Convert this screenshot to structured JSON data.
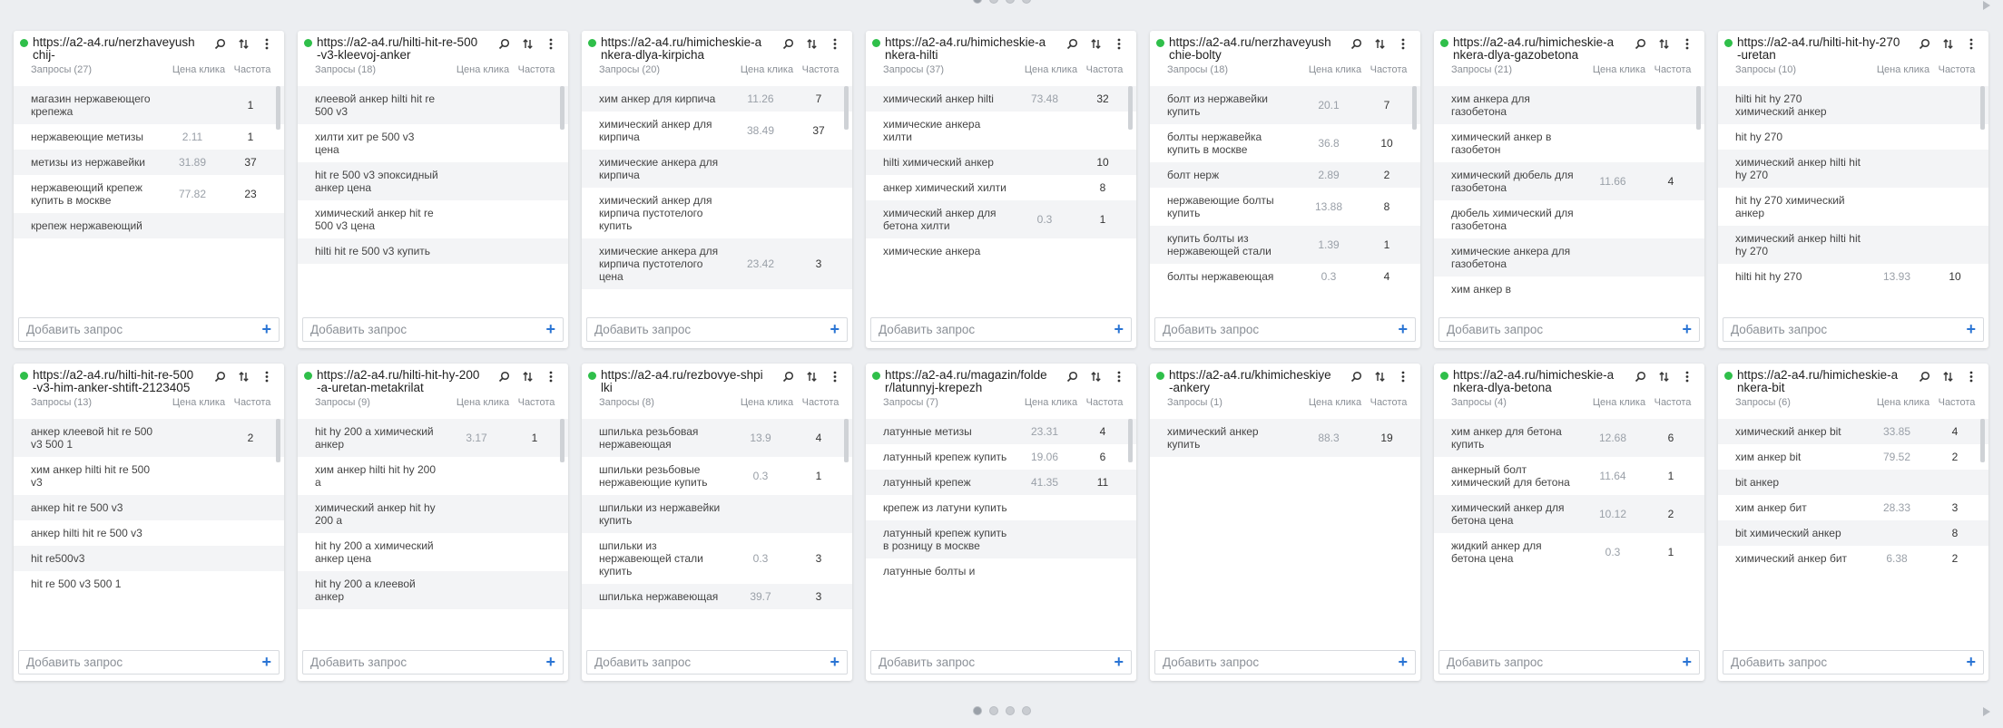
{
  "pager": {
    "count": 4,
    "active": 0
  },
  "labels": {
    "col_price": "Цена клика",
    "col_freq": "Частота",
    "add_query": "Добавить запрос",
    "add_plus": "+"
  },
  "cards": [
    {
      "url": "https://a2-a4.ru/nerzhaveyushchij-",
      "count": "Запросы (27)",
      "rows": [
        {
          "q": "магазин нержавеющего крепежа",
          "p": "",
          "f": "1"
        },
        {
          "q": "нержавеющие метизы",
          "p": "2.11",
          "f": "1"
        },
        {
          "q": "метизы из нержавейки",
          "p": "31.89",
          "f": "37"
        },
        {
          "q": "нержавеющий крепеж купить в москве",
          "p": "77.82",
          "f": "23"
        },
        {
          "q": "крепеж нержавеющий",
          "p": "",
          "f": ""
        }
      ]
    },
    {
      "url": "https://a2-a4.ru/hilti-hit-re-500-v3-kleevoj-anker",
      "count": "Запросы (18)",
      "rows": [
        {
          "q": "клеевой анкер hilti hit re 500 v3",
          "p": "",
          "f": ""
        },
        {
          "q": "хилти хит ре 500 v3 цена",
          "p": "",
          "f": ""
        },
        {
          "q": "hit re 500 v3 эпоксидный анкер цена",
          "p": "",
          "f": ""
        },
        {
          "q": "химический анкер hit re 500 v3 цена",
          "p": "",
          "f": ""
        },
        {
          "q": "hilti hit re 500 v3 купить",
          "p": "",
          "f": ""
        }
      ]
    },
    {
      "url": "https://a2-a4.ru/himicheskie-ankera-dlya-kirpicha",
      "count": "Запросы (20)",
      "rows": [
        {
          "q": "хим анкер для кирпича",
          "p": "11.26",
          "f": "7"
        },
        {
          "q": "химический анкер для кирпича",
          "p": "38.49",
          "f": "37"
        },
        {
          "q": "химические анкера для кирпича",
          "p": "",
          "f": ""
        },
        {
          "q": "химический анкер для кирпича пустотелого купить",
          "p": "",
          "f": ""
        },
        {
          "q": "химические анкера для кирпича пустотелого цена",
          "p": "23.42",
          "f": "3"
        }
      ]
    },
    {
      "url": "https://a2-a4.ru/himicheskie-ankera-hilti",
      "count": "Запросы (37)",
      "rows": [
        {
          "q": "химический анкер hilti",
          "p": "73.48",
          "f": "32"
        },
        {
          "q": "химические анкера хилти",
          "p": "",
          "f": ""
        },
        {
          "q": "hilti химический анкер",
          "p": "",
          "f": "10"
        },
        {
          "q": "анкер химический хилти",
          "p": "",
          "f": "8"
        },
        {
          "q": "химический анкер для бетона хилти",
          "p": "0.3",
          "f": "1"
        },
        {
          "q": "химические анкера",
          "p": "",
          "f": ""
        }
      ]
    },
    {
      "url": "https://a2-a4.ru/nerzhaveyushchie-bolty",
      "count": "Запросы (18)",
      "rows": [
        {
          "q": "болт из нержавейки купить",
          "p": "20.1",
          "f": "7"
        },
        {
          "q": "болты нержавейка купить в москве",
          "p": "36.8",
          "f": "10"
        },
        {
          "q": "болт нерж",
          "p": "2.89",
          "f": "2"
        },
        {
          "q": "нержавеющие болты купить",
          "p": "13.88",
          "f": "8"
        },
        {
          "q": "купить болты из нержавеющей стали",
          "p": "1.39",
          "f": "1"
        },
        {
          "q": "болты нержавеющая",
          "p": "0.3",
          "f": "4"
        }
      ]
    },
    {
      "url": "https://a2-a4.ru/himicheskie-ankera-dlya-gazobetona",
      "count": "Запросы (21)",
      "rows": [
        {
          "q": "хим анкера для газобетона",
          "p": "",
          "f": ""
        },
        {
          "q": "химический анкер в газобетон",
          "p": "",
          "f": ""
        },
        {
          "q": "химический дюбель для газобетона",
          "p": "11.66",
          "f": "4"
        },
        {
          "q": "дюбель химический для газобетона",
          "p": "",
          "f": ""
        },
        {
          "q": "химические анкера для газобетона",
          "p": "",
          "f": ""
        },
        {
          "q": "хим анкер в",
          "p": "",
          "f": ""
        }
      ]
    },
    {
      "url": "https://a2-a4.ru/hilti-hit-hy-270-uretan",
      "count": "Запросы (10)",
      "rows": [
        {
          "q": "hilti hit hy 270 химический анкер",
          "p": "",
          "f": ""
        },
        {
          "q": "hit hy 270",
          "p": "",
          "f": ""
        },
        {
          "q": "химический анкер hilti hit hy 270",
          "p": "",
          "f": ""
        },
        {
          "q": "hit hy 270 химический анкер",
          "p": "",
          "f": ""
        },
        {
          "q": "химический анкер hilti hit hy 270",
          "p": "",
          "f": ""
        },
        {
          "q": "hilti hit hy 270",
          "p": "13.93",
          "f": "10"
        }
      ]
    },
    {
      "url": "https://a2-a4.ru/hilti-hit-re-500-v3-him-anker-shtift-2123405",
      "count": "Запросы (13)",
      "rows": [
        {
          "q": "анкер клеевой hit re 500 v3 500 1",
          "p": "",
          "f": "2"
        },
        {
          "q": "хим анкер hilti hit re 500 v3",
          "p": "",
          "f": ""
        },
        {
          "q": "анкер hit re 500 v3",
          "p": "",
          "f": ""
        },
        {
          "q": "анкер hilti hit re 500 v3",
          "p": "",
          "f": ""
        },
        {
          "q": "hit re500v3",
          "p": "",
          "f": ""
        },
        {
          "q": "hit re 500 v3 500 1",
          "p": "",
          "f": ""
        }
      ]
    },
    {
      "url": "https://a2-a4.ru/hilti-hit-hy-200-a-uretan-metakrilat",
      "count": "Запросы (9)",
      "rows": [
        {
          "q": "hit hy 200 а химический анкер",
          "p": "3.17",
          "f": "1"
        },
        {
          "q": "хим анкер hilti hit hy 200 a",
          "p": "",
          "f": ""
        },
        {
          "q": "химический анкер hit hy 200 a",
          "p": "",
          "f": ""
        },
        {
          "q": "hit hy 200 а химический анкер цена",
          "p": "",
          "f": ""
        },
        {
          "q": "hit hy 200 а клеевой анкер",
          "p": "",
          "f": ""
        }
      ]
    },
    {
      "url": "https://a2-a4.ru/rezbovye-shpilki",
      "count": "Запросы (8)",
      "rows": [
        {
          "q": "шпилька резьбовая нержавеющая",
          "p": "13.9",
          "f": "4"
        },
        {
          "q": "шпильки резьбовые нержавеющие купить",
          "p": "0.3",
          "f": "1"
        },
        {
          "q": "шпильки из нержавейки купить",
          "p": "",
          "f": ""
        },
        {
          "q": "шпильки из нержавеющей стали купить",
          "p": "0.3",
          "f": "3"
        },
        {
          "q": "шпилька нержавеющая",
          "p": "39.7",
          "f": "3"
        }
      ]
    },
    {
      "url": "https://a2-a4.ru/magazin/folder/latunnyj-krepezh",
      "count": "Запросы (7)",
      "rows": [
        {
          "q": "латунные метизы",
          "p": "23.31",
          "f": "4"
        },
        {
          "q": "латунный крепеж купить",
          "p": "19.06",
          "f": "6"
        },
        {
          "q": "латунный крепеж",
          "p": "41.35",
          "f": "11"
        },
        {
          "q": "крепеж из латуни купить",
          "p": "",
          "f": ""
        },
        {
          "q": "латунный крепеж купить в розницу в москве",
          "p": "",
          "f": ""
        },
        {
          "q": "латунные болты и",
          "p": "",
          "f": ""
        }
      ]
    },
    {
      "url": "https://a2-a4.ru/khimicheskiye-ankery",
      "count": "Запросы (1)",
      "rows": [
        {
          "q": "химический анкер купить",
          "p": "88.3",
          "f": "19"
        }
      ]
    },
    {
      "url": "https://a2-a4.ru/himicheskie-ankera-dlya-betona",
      "count": "Запросы (4)",
      "rows": [
        {
          "q": "хим анкер для бетона купить",
          "p": "12.68",
          "f": "6"
        },
        {
          "q": "анкерный болт химический для бетона",
          "p": "11.64",
          "f": "1"
        },
        {
          "q": "химический анкер для бетона цена",
          "p": "10.12",
          "f": "2"
        },
        {
          "q": "жидкий анкер для бетона цена",
          "p": "0.3",
          "f": "1"
        }
      ]
    },
    {
      "url": "https://a2-a4.ru/himicheskie-ankera-bit",
      "count": "Запросы (6)",
      "rows": [
        {
          "q": "химический анкер bit",
          "p": "33.85",
          "f": "4"
        },
        {
          "q": "хим анкер bit",
          "p": "79.52",
          "f": "2"
        },
        {
          "q": "bit анкер",
          "p": "",
          "f": ""
        },
        {
          "q": "хим анкер бит",
          "p": "28.33",
          "f": "3"
        },
        {
          "q": "bit химический анкер",
          "p": "",
          "f": "8"
        },
        {
          "q": "химический анкер бит",
          "p": "6.38",
          "f": "2"
        }
      ]
    }
  ]
}
